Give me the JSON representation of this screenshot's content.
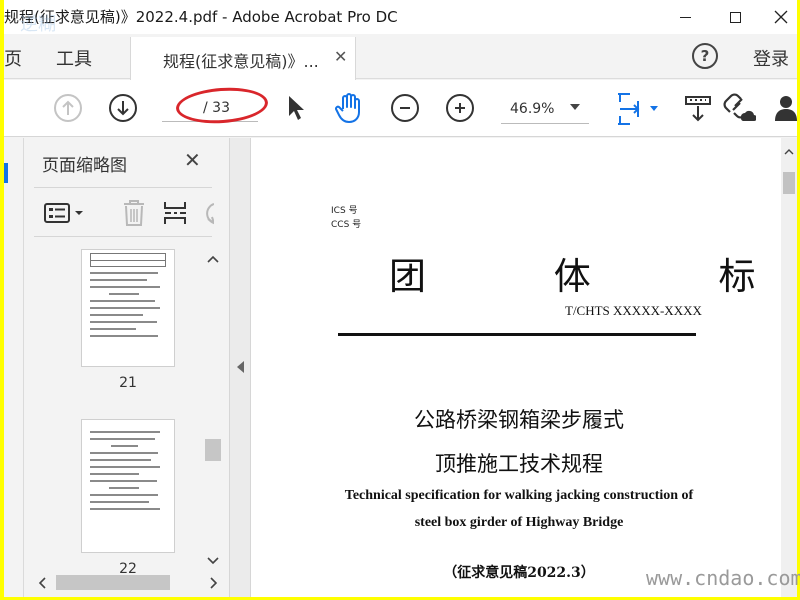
{
  "window": {
    "title": "规程(征求意见稿)》2022.4.pdf - Adobe Acrobat Pro DC",
    "corner_watermark": "逆糊"
  },
  "tabs": {
    "home_partial": "页",
    "tools": "工具",
    "document": "规程(征求意见稿)》...",
    "help": "?",
    "login": "登录"
  },
  "toolbar": {
    "page_total": "/ 33",
    "zoom": "46.9%"
  },
  "thumbnails": {
    "title": "页面缩略图",
    "pages": [
      {
        "number": "21"
      },
      {
        "number": "22"
      }
    ]
  },
  "document": {
    "ics": "ICS 号",
    "ccs": "CCS 号",
    "type_title": "团 体 标 准",
    "doc_number": "T/CHTS XXXXX-XXXX",
    "title_cn_line1": "公路桥梁钢箱梁步履式",
    "title_cn_line2": "顶推施工技术规程",
    "title_en_line1": "Technical specification for walking jacking construction of",
    "title_en_line2": "steel box girder of Highway Bridge",
    "draft_note": "（征求意见稿2022.3）"
  },
  "watermark": "www.cndao.com",
  "colors": {
    "accent_blue": "#1473e6",
    "annotation_red": "#d9262b",
    "highlight_border": "#ffff00"
  }
}
